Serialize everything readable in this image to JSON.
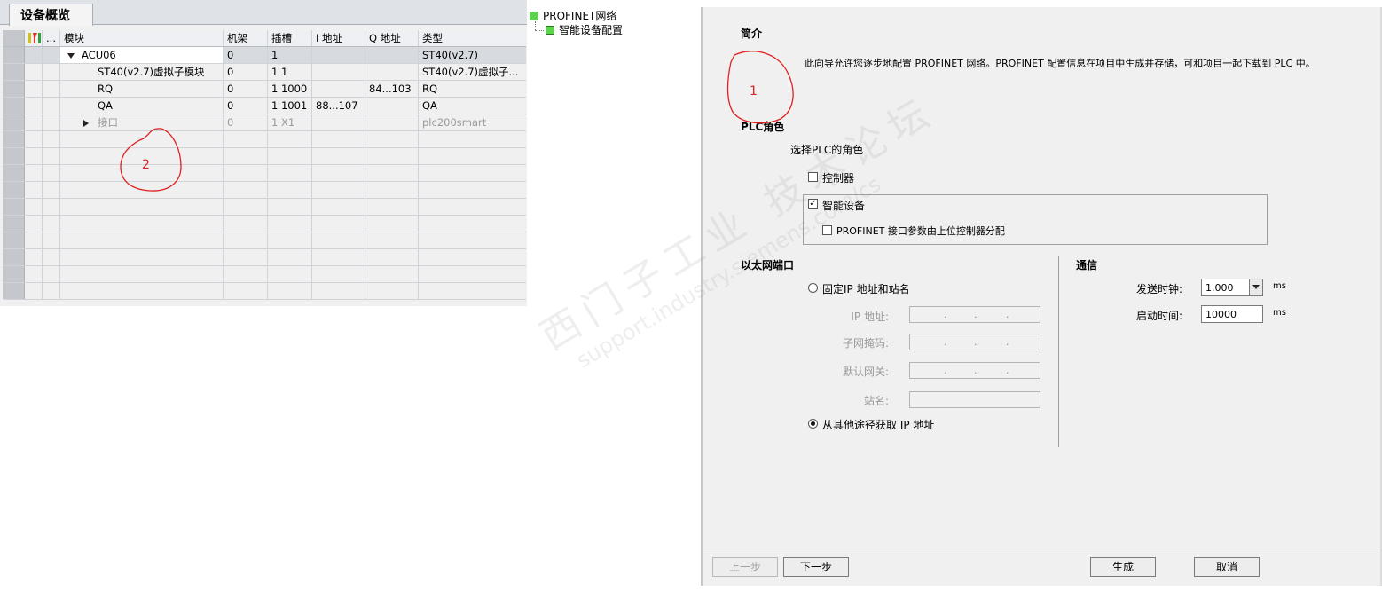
{
  "device_overview": {
    "tab_label": "设备概览",
    "columns": {
      "dots": "...",
      "module": "模块",
      "rack": "机架",
      "slot": "插槽",
      "i_address": "I 地址",
      "q_address": "Q 地址",
      "type": "类型"
    },
    "rows": [
      {
        "module": "ACU06",
        "rack": "0",
        "slot": "1",
        "i_address": "",
        "q_address": "",
        "type": "ST40(v2.7)"
      },
      {
        "module": "ST40(v2.7)虚拟子模块",
        "rack": "0",
        "slot": "1 1",
        "i_address": "",
        "q_address": "",
        "type": "ST40(v2.7)虚拟子..."
      },
      {
        "module": "RQ",
        "rack": "0",
        "slot": "1 1000",
        "i_address": "",
        "q_address": "84...103",
        "type": "RQ"
      },
      {
        "module": "QA",
        "rack": "0",
        "slot": "1 1001",
        "i_address": "88...107",
        "q_address": "",
        "type": "QA"
      },
      {
        "module": "接口",
        "rack": "0",
        "slot": "1 X1",
        "i_address": "",
        "q_address": "",
        "type": "plc200smart"
      }
    ]
  },
  "tree": {
    "root": "PROFINET网络",
    "child": "智能设备配置"
  },
  "wizard": {
    "intro_title": "简介",
    "intro_text": "此向导允许您逐步地配置 PROFINET 网络。PROFINET 配置信息在项目中生成并存储，可和项目一起下载到 PLC 中。",
    "plc_role_title": "PLC角色",
    "plc_role_prompt": "选择PLC的角色",
    "controller_label": "控制器",
    "controller_checked": false,
    "smart_device_label": "智能设备",
    "smart_device_checked": true,
    "profinet_param_label": "PROFINET 接口参数由上位控制器分配",
    "profinet_param_checked": false,
    "ethernet_title": "以太网端口",
    "fixed_ip_label": "固定IP 地址和站名",
    "ip_label": "IP 地址:",
    "subnet_label": "子网掩码:",
    "gateway_label": "默认网关:",
    "station_label": "站名:",
    "ip_dots": ".",
    "other_ip_label": "从其他途径获取 IP 地址",
    "comm_title": "通信",
    "send_clock_label": "发送时钟:",
    "send_clock_value": "1.000",
    "startup_time_label": "启动时间:",
    "startup_time_value": "10000",
    "unit_ms": "ms",
    "btn_prev": "上一步",
    "btn_next": "下一步",
    "btn_generate": "生成",
    "btn_cancel": "取消"
  },
  "annotations": {
    "mark1": "1",
    "mark2": "2"
  },
  "watermark": {
    "line1": "西门子工业 技术论坛",
    "line2": "support.industry.siemens.com/cs"
  }
}
